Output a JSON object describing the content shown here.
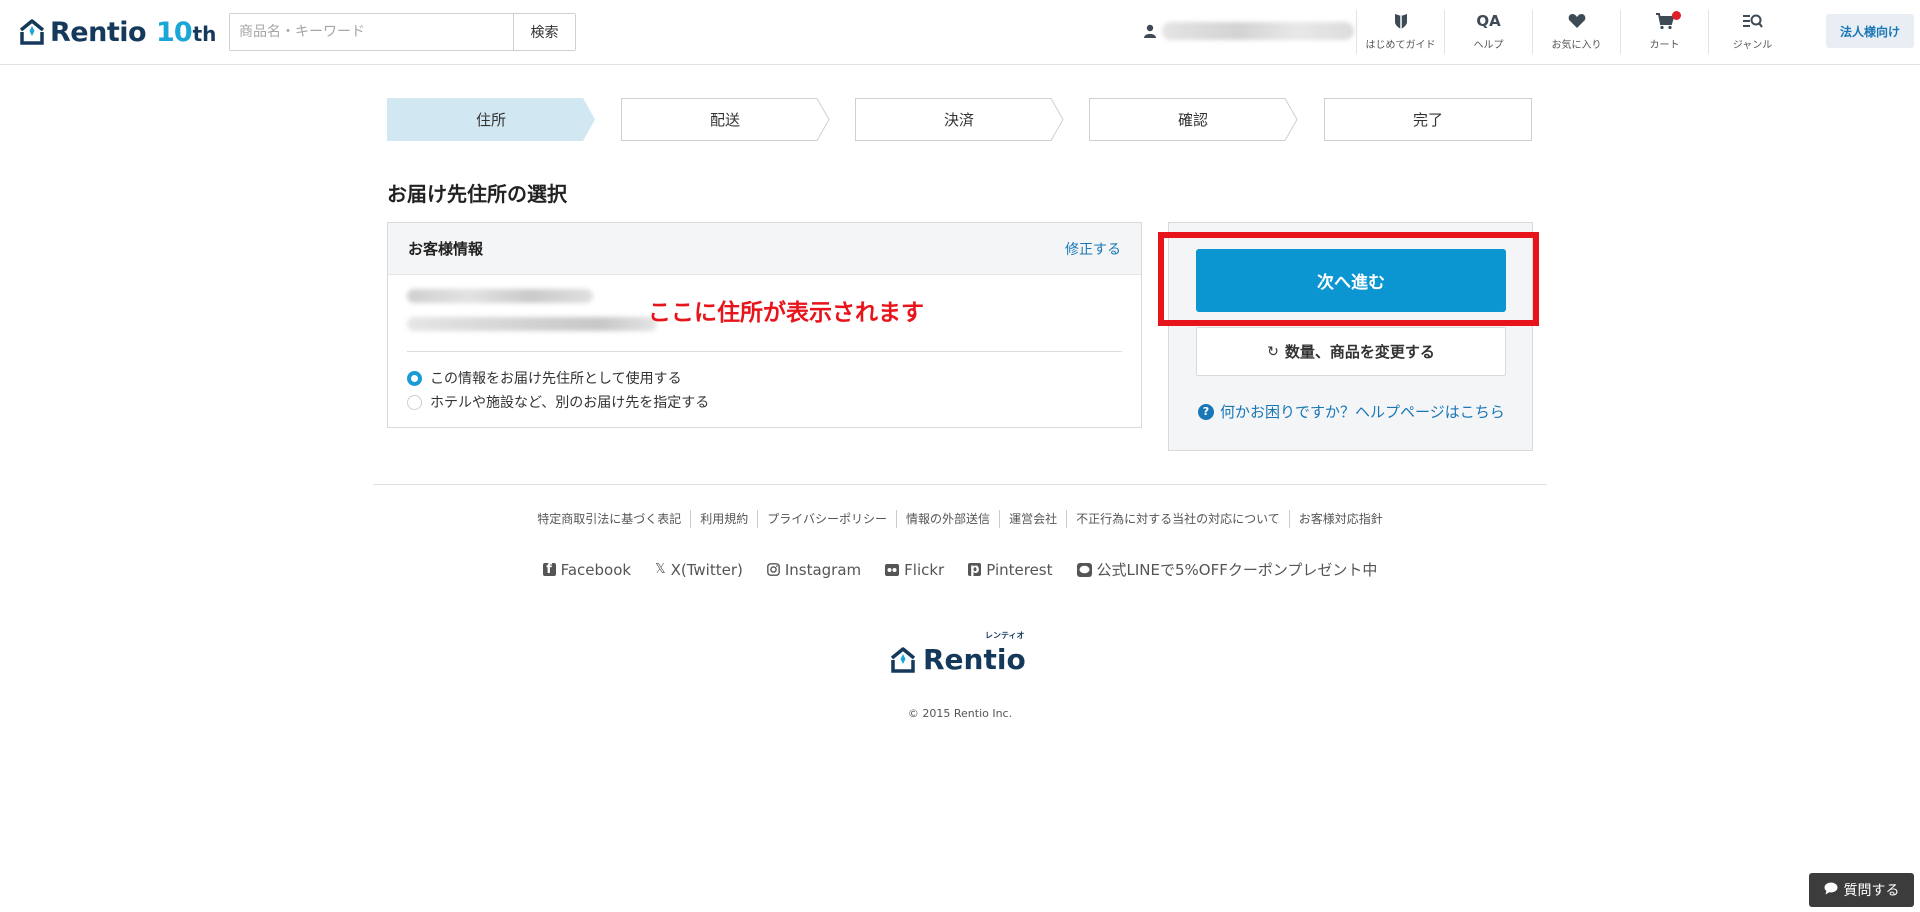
{
  "header": {
    "logo_text": "Rentio",
    "logo_anniv_number": "10",
    "logo_anniv_suffix": "th",
    "search_placeholder": "商品名・キーワード",
    "search_button": "検索",
    "nav": [
      {
        "label": "はじめてガイド",
        "icon": "shield-icon"
      },
      {
        "label": "ヘルプ",
        "icon": "qa-icon",
        "glyph": "QA"
      },
      {
        "label": "お気に入り",
        "icon": "heart-icon"
      },
      {
        "label": "カート",
        "icon": "cart-icon"
      },
      {
        "label": "ジャンル",
        "icon": "genre-search-icon"
      }
    ],
    "corporate_button": "法人様向け"
  },
  "steps": [
    "住所",
    "配送",
    "決済",
    "確認",
    "完了"
  ],
  "active_step": "住所",
  "page_title": "お届け先住所の選択",
  "customer_info": {
    "title": "お客様情報",
    "edit_link": "修正する",
    "annotation": "ここに住所が表示されます",
    "options": [
      {
        "label": "この情報をお届け先住所として使用する",
        "selected": true
      },
      {
        "label": "ホテルや施設など、別のお届け先を指定する",
        "selected": false
      }
    ]
  },
  "side_panel": {
    "next_button": "次へ進む",
    "change_button": "数量、商品を変更する",
    "help_link": "何かお困りですか？ヘルプページはこちら",
    "help_icon_glyph": "?"
  },
  "footer": {
    "links": [
      "特定商取引法に基づく表記",
      "利用規約",
      "プライバシーポリシー",
      "情報の外部送信",
      "運営会社",
      "不正行為に対する当社の対応について",
      "お客様対応指針"
    ],
    "social": [
      {
        "label": "Facebook",
        "icon": "facebook-icon"
      },
      {
        "label": "X(Twitter)",
        "icon": "x-icon"
      },
      {
        "label": "Instagram",
        "icon": "instagram-icon"
      },
      {
        "label": "Flickr",
        "icon": "flickr-icon"
      },
      {
        "label": "Pinterest",
        "icon": "pinterest-icon"
      },
      {
        "label": "公式LINEで5%OFFクーポンプレゼント中",
        "icon": "line-icon"
      }
    ],
    "logo_text": "Rentio",
    "logo_kana": "レンティオ",
    "copyright": "© 2015 Rentio Inc."
  },
  "chat_button": "質問する",
  "colors": {
    "brand_navy": "#14395b",
    "accent_blue": "#0b95d1",
    "link_blue": "#1977b6",
    "active_step": "#d1e8f3",
    "annotation_red": "#e8141c"
  }
}
